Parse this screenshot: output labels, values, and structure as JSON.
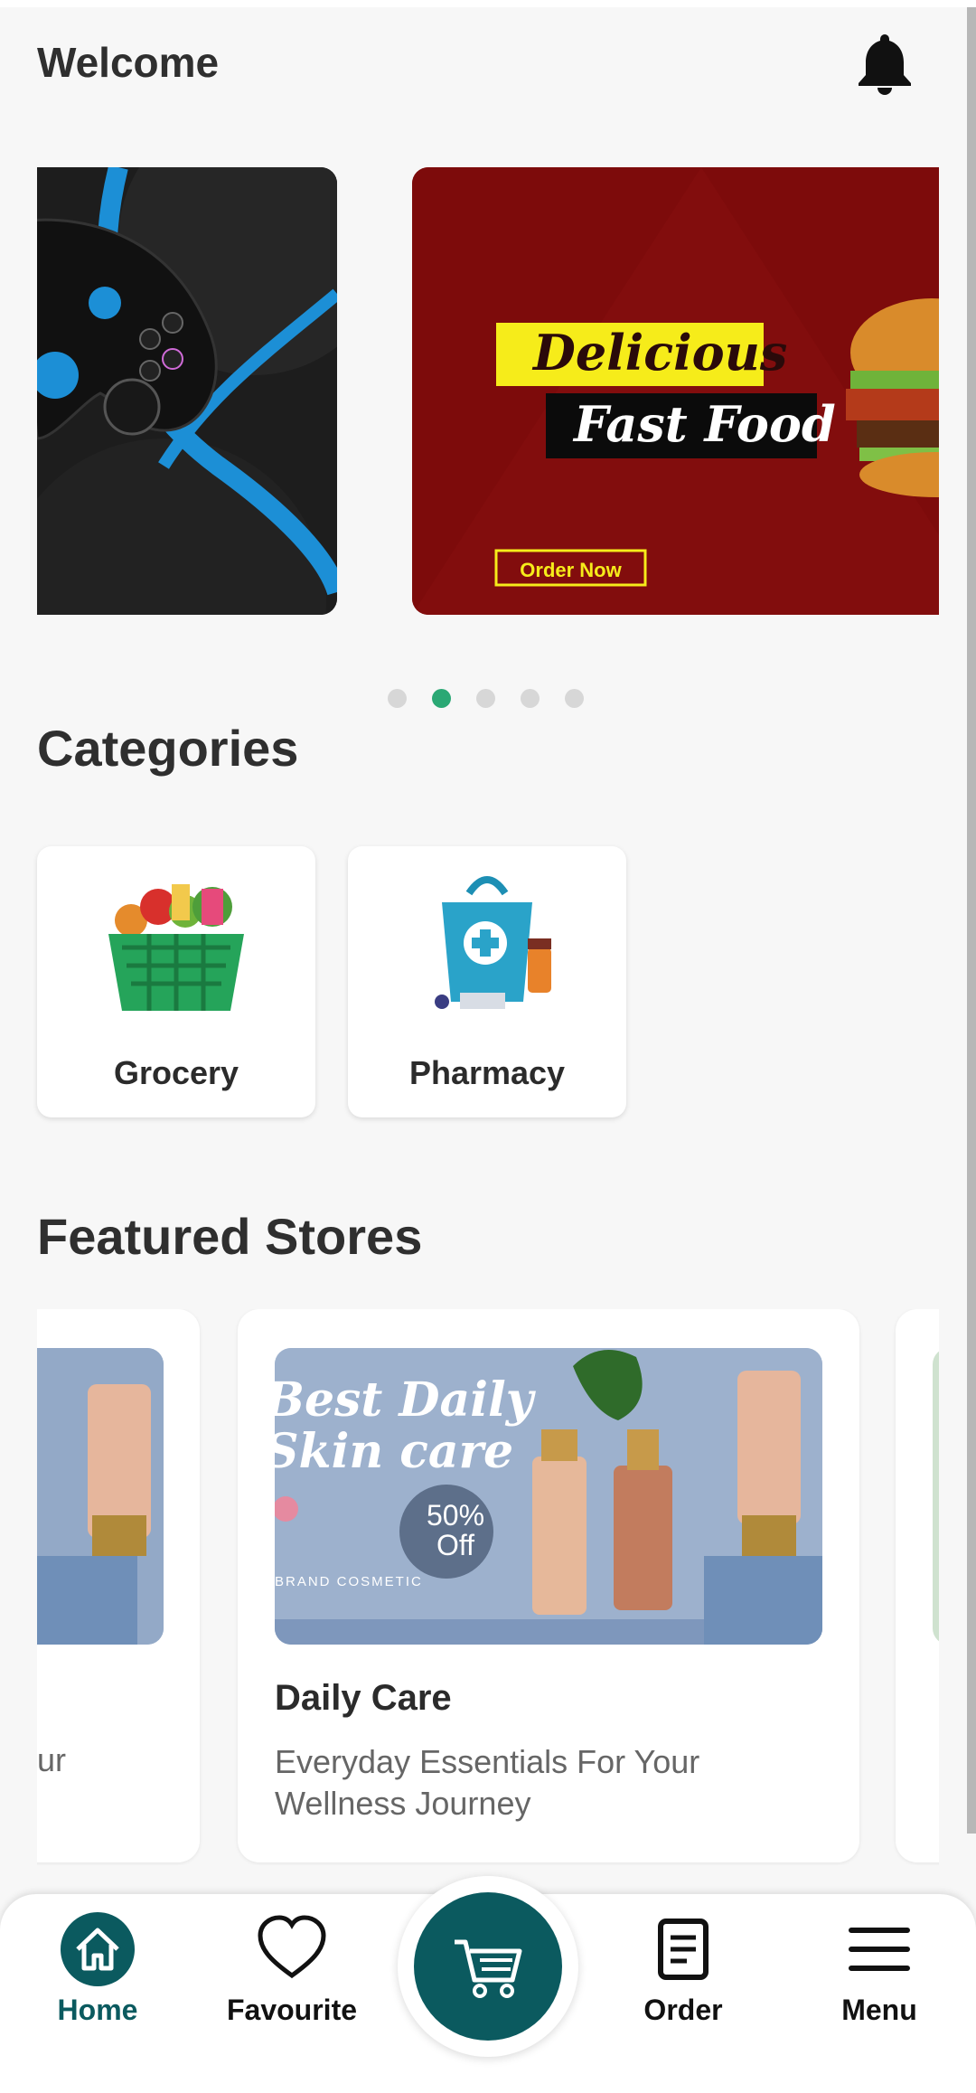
{
  "header": {
    "title": "Welcome"
  },
  "banners": [
    {
      "name": "game-controller"
    },
    {
      "line1": "Delicious",
      "line2": "Fast Food",
      "cta": "Order Now"
    }
  ],
  "carousel": {
    "page_count": 5,
    "active_index": 1
  },
  "categories": {
    "title": "Categories",
    "items": [
      {
        "label": "Grocery"
      },
      {
        "label": "Pharmacy"
      }
    ]
  },
  "featured": {
    "title": "Featured Stores",
    "left_card_desc_fragment": "ur",
    "main_card": {
      "name": "Daily Care",
      "description": "Everyday Essentials For Your Wellness Journey",
      "banner_headline_1": "Best Daily",
      "banner_headline_2": "Skin care",
      "discount_1": "50%",
      "discount_2": "Off",
      "brand_label": "BRAND COSMETIC",
      "brand_text": "BRAND"
    }
  },
  "nav": {
    "items": [
      {
        "label": "Home",
        "icon": "home-icon"
      },
      {
        "label": "Favourite",
        "icon": "heart-icon"
      },
      {
        "label": "Order",
        "icon": "document-icon"
      },
      {
        "label": "Menu",
        "icon": "menu-icon"
      }
    ],
    "cart_icon": "cart-icon"
  },
  "colors": {
    "accent": "#0b5a5f",
    "dot_active": "#2aa874",
    "banner_red": "#7d0b0b"
  }
}
